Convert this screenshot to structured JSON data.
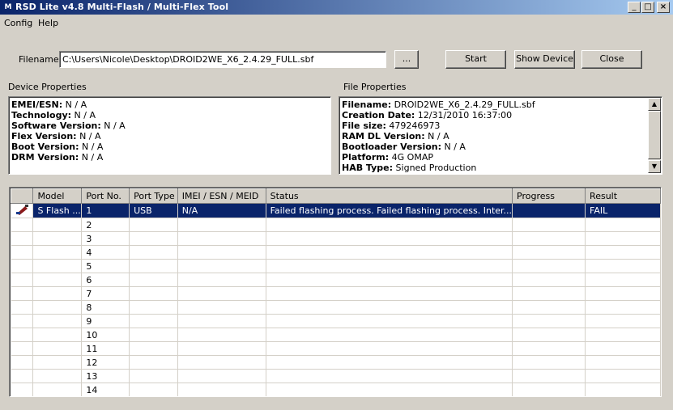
{
  "window": {
    "title": "RSD Lite v4.8 Multi-Flash / Multi-Flex Tool",
    "app_icon": "motorola-logo",
    "controls": [
      "minimize",
      "maximize",
      "close"
    ]
  },
  "menu": {
    "items": [
      "Config",
      "Help"
    ]
  },
  "filename": {
    "label": "Filename:",
    "value": "C:\\Users\\Nicole\\Desktop\\DROID2WE_X6_2.4.29_FULL.sbf",
    "browse_label": "..."
  },
  "buttons": {
    "start": "Start",
    "show_device": "Show Device",
    "close": "Close"
  },
  "device_properties": {
    "title": "Device Properties",
    "rows": [
      {
        "key": "EMEI/ESN:",
        "value": " N / A"
      },
      {
        "key": "Technology:",
        "value": " N / A"
      },
      {
        "key": "Software Version:",
        "value": " N / A"
      },
      {
        "key": "Flex Version:",
        "value": " N / A"
      },
      {
        "key": "Boot Version:",
        "value": " N / A"
      },
      {
        "key": "DRM Version:",
        "value": " N / A"
      }
    ]
  },
  "file_properties": {
    "title": "File Properties",
    "rows": [
      {
        "key": "Filename:",
        "value": " DROID2WE_X6_2.4.29_FULL.sbf"
      },
      {
        "key": "Creation Date:",
        "value": " 12/31/2010 16:37:00"
      },
      {
        "key": "File size:",
        "value": " 479246973"
      },
      {
        "key": "RAM DL Version:",
        "value": " N / A"
      },
      {
        "key": "Bootloader Version:",
        "value": " N / A"
      },
      {
        "key": "Platform:",
        "value": " 4G OMAP"
      },
      {
        "key": "HAB Type:",
        "value": " Signed Production"
      }
    ]
  },
  "device_table": {
    "columns": [
      "",
      "Model",
      "Port No.",
      "Port Type",
      "IMEI / ESN / MEID",
      "Status",
      "Progress",
      "Result"
    ],
    "rows": [
      {
        "icon": "usb-phone-icon",
        "model": "S Flash ...",
        "port": "1",
        "port_type": "USB",
        "imei": "N/A",
        "status": "Failed flashing process. Failed flashing process. Inter...",
        "progress": "",
        "result": "FAIL",
        "selected": true
      },
      {
        "port": "2"
      },
      {
        "port": "3"
      },
      {
        "port": "4"
      },
      {
        "port": "5"
      },
      {
        "port": "6"
      },
      {
        "port": "7"
      },
      {
        "port": "8"
      },
      {
        "port": "9"
      },
      {
        "port": "10"
      },
      {
        "port": "11"
      },
      {
        "port": "12"
      },
      {
        "port": "13"
      },
      {
        "port": "14"
      }
    ]
  }
}
